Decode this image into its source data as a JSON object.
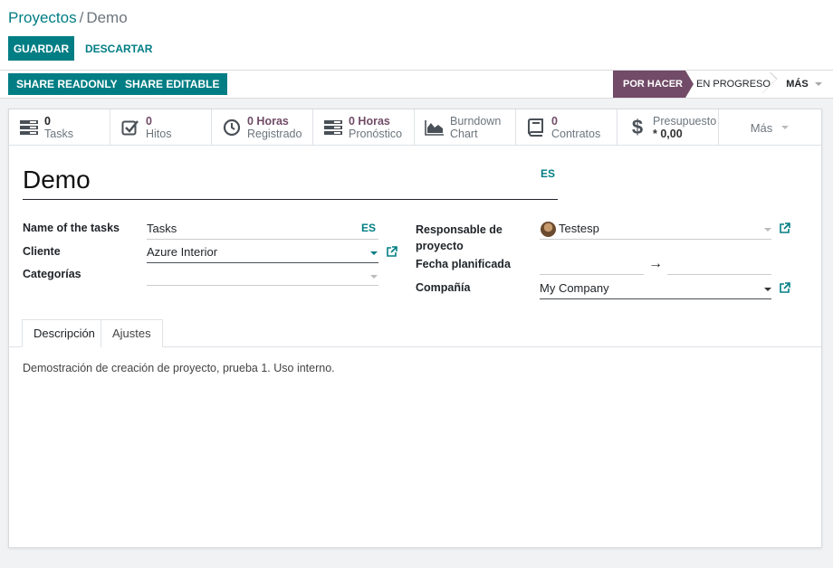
{
  "breadcrumb": {
    "parent": "Proyectos",
    "separator": "/",
    "current": "Demo"
  },
  "toolbar": {
    "save_label": "GUARDAR",
    "discard_label": "DESCARTAR"
  },
  "statusbar": {
    "share_readonly": "SHARE READONLY",
    "share_editable": "SHARE EDITABLE",
    "stages": [
      "POR HACER",
      "EN PROGRESO"
    ],
    "active_stage": "POR HACER",
    "more_label": "MÁS"
  },
  "smart_buttons": [
    {
      "icon": "tasks-icon",
      "value": "0",
      "label": "Tasks"
    },
    {
      "icon": "check-square-icon",
      "value": "0",
      "label": "Hitos"
    },
    {
      "icon": "clock-icon",
      "value": "0 Horas",
      "label": "Registrado"
    },
    {
      "icon": "tasks-icon",
      "value": "0 Horas",
      "label": "Pronóstico"
    },
    {
      "icon": "area-chart-icon",
      "value": "Burndown",
      "label": "Chart"
    },
    {
      "icon": "book-icon",
      "value": "0",
      "label": "Contratos"
    },
    {
      "icon": "dollar-icon",
      "value": "Presupuesto",
      "label": "* 0,00"
    }
  ],
  "smart_more": "Más",
  "project": {
    "name": "Demo",
    "name_lang": "ES",
    "fields": {
      "tasks_label": "Name of the tasks",
      "tasks_value": "Tasks",
      "tasks_lang": "ES",
      "client_label": "Cliente",
      "client_value": "Azure Interior",
      "categories_label": "Categorías",
      "categories_value": "",
      "manager_label_1": "Responsable de",
      "manager_label_2": "proyecto",
      "manager_value": "Testesp",
      "date_label": "Fecha planificada",
      "date_arrow": "→",
      "company_label": "Compañía",
      "company_value": "My Company"
    }
  },
  "tabs": [
    "Descripción",
    "Ajustes"
  ],
  "active_tab": "Descripción",
  "description": "Demostración de creación de proyecto, prueba 1. Uso interno.",
  "colors": {
    "primary": "#017e84",
    "stage_active": "#714b67"
  }
}
